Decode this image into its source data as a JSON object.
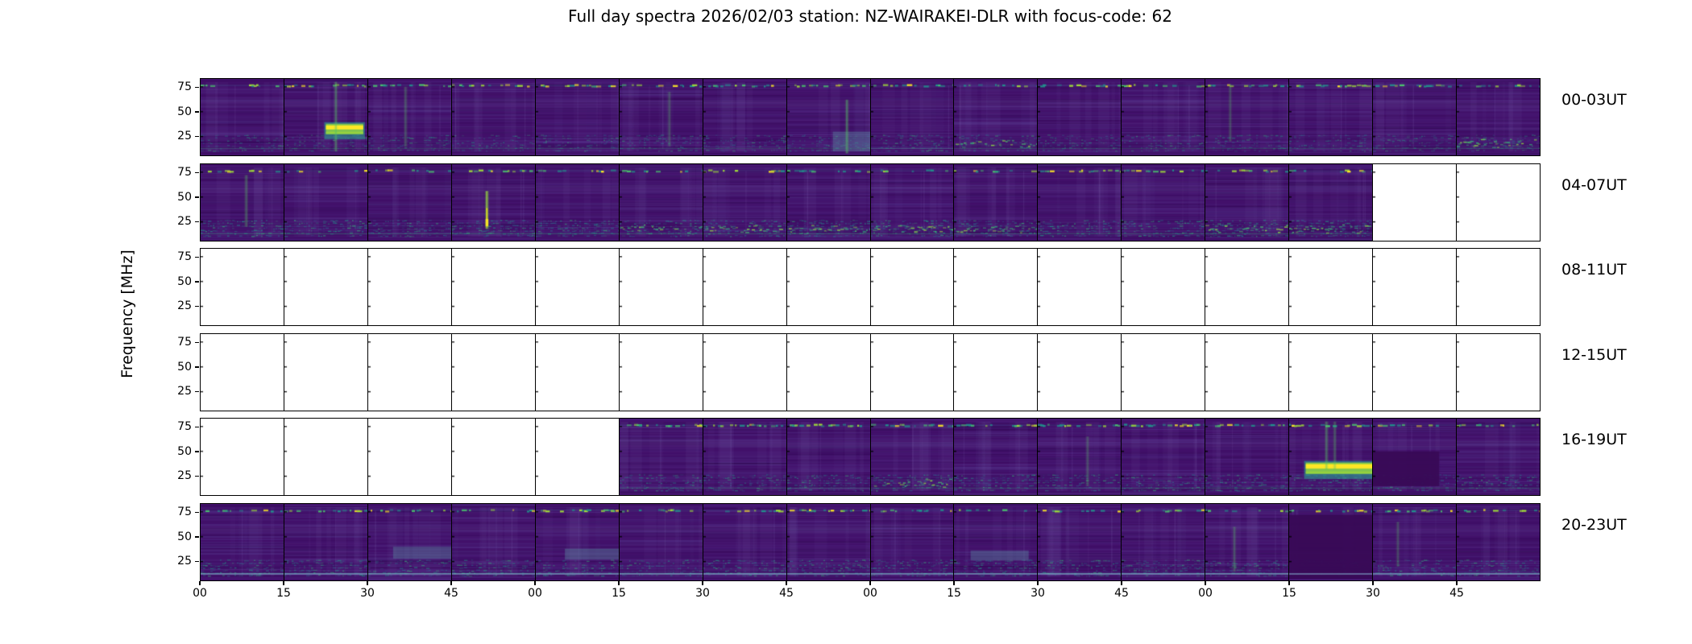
{
  "title": "Full day spectra 2026/02/03 station: NZ-WAIRAKEI-DLR with focus-code: 62",
  "ylabel": "Frequency [MHz]",
  "station": "NZ-WAIRAKEI-DLR",
  "date": "2026/02/03",
  "focus_code": "62",
  "colors": {
    "background": "#ffffff",
    "axis": "#000000",
    "spectrogram_base": "#42106a",
    "no_data": "#ffffff",
    "viridis_palette": [
      "#440154",
      "#46327e",
      "#365c8d",
      "#277f8e",
      "#1fa187",
      "#4ac16d",
      "#a0da39",
      "#fde725"
    ]
  },
  "chart_data": {
    "type": "heatmap",
    "subtype": "spectrogram-grid",
    "colormap": "viridis",
    "panels_per_row": 16,
    "minutes_per_panel": 15,
    "x_tick_labels": [
      "00",
      "15",
      "30",
      "45",
      "00",
      "15",
      "30",
      "45",
      "00",
      "15",
      "30",
      "45",
      "00",
      "15",
      "30",
      "45"
    ],
    "y_ticks": [
      "75",
      "50",
      "25"
    ],
    "y_tick_freqs": [
      75,
      50,
      25
    ],
    "y_range_mhz": [
      6,
      83
    ],
    "rows": [
      {
        "label": "00-03UT",
        "panels": [
          1,
          1,
          1,
          1,
          1,
          1,
          1,
          1,
          1,
          1,
          1,
          1,
          1,
          1,
          1,
          1
        ],
        "top_band": 0.5,
        "bottom_band": 0.62,
        "bottom_line": false
      },
      {
        "label": "04-07UT",
        "panels": [
          1,
          1,
          1,
          1,
          1,
          1,
          1,
          1,
          1,
          1,
          1,
          1,
          1,
          1,
          0,
          0
        ],
        "top_band": 0.45,
        "bottom_band": 0.82,
        "bottom_line": false
      },
      {
        "label": "08-11UT",
        "panels": [
          0,
          0,
          0,
          0,
          0,
          0,
          0,
          0,
          0,
          0,
          0,
          0,
          0,
          0,
          0,
          0
        ],
        "top_band": 0,
        "bottom_band": 0,
        "bottom_line": false
      },
      {
        "label": "12-15UT",
        "panels": [
          0,
          0,
          0,
          0,
          0,
          0,
          0,
          0,
          0,
          0,
          0,
          0,
          0,
          0,
          0,
          0
        ],
        "top_band": 0,
        "bottom_band": 0,
        "bottom_line": false
      },
      {
        "label": "16-19UT",
        "panels": [
          0,
          0,
          0,
          0,
          0,
          1,
          1,
          1,
          1,
          1,
          1,
          1,
          1,
          1,
          1,
          1
        ],
        "top_band": 0.55,
        "bottom_band": 0.7,
        "bottom_line": false
      },
      {
        "label": "20-23UT",
        "panels": [
          1,
          1,
          1,
          1,
          1,
          1,
          1,
          1,
          1,
          1,
          1,
          1,
          1,
          1,
          1,
          1
        ],
        "top_band": 0.42,
        "bottom_band": 0.72,
        "bottom_line": true
      }
    ],
    "features": [
      {
        "row": 0,
        "panel": 1,
        "type": "blob",
        "x0": 0.5,
        "x1": 0.95,
        "f0": 28,
        "f1": 37,
        "note": "bright narrowband emission"
      },
      {
        "row": 0,
        "panel": 1,
        "type": "vstreak",
        "x": 0.62,
        "f0": 10,
        "f1": 80,
        "intensity": 0.5
      },
      {
        "row": 0,
        "panel": 2,
        "type": "vstreak",
        "x": 0.45,
        "f0": 15,
        "f1": 75,
        "intensity": 0.35
      },
      {
        "row": 0,
        "panel": 5,
        "type": "vstreak",
        "x": 0.6,
        "f0": 15,
        "f1": 70,
        "intensity": 0.3
      },
      {
        "row": 0,
        "panel": 7,
        "type": "light-rect",
        "x0": 0.55,
        "x1": 1,
        "f0": 10,
        "f1": 30
      },
      {
        "row": 0,
        "panel": 7,
        "type": "vstreak",
        "x": 0.72,
        "f0": 8,
        "f1": 62,
        "intensity": 0.55
      },
      {
        "row": 0,
        "panel": 9,
        "type": "strong-bottom"
      },
      {
        "row": 0,
        "panel": 12,
        "type": "vstreak",
        "x": 0.3,
        "f0": 20,
        "f1": 78,
        "intensity": 0.3
      },
      {
        "row": 0,
        "panel": 15,
        "type": "strong-bottom"
      },
      {
        "row": 1,
        "panel": 0,
        "type": "vstreak",
        "x": 0.55,
        "f0": 20,
        "f1": 72,
        "intensity": 0.4
      },
      {
        "row": 1,
        "panel": 3,
        "type": "vstreak",
        "x": 0.42,
        "f0": 18,
        "f1": 56,
        "intensity": 0.95,
        "note": "strong vertical burst"
      },
      {
        "row": 1,
        "panel": 5,
        "type": "strong-bottom"
      },
      {
        "row": 1,
        "panel": 6,
        "type": "strong-bottom"
      },
      {
        "row": 1,
        "panel": 7,
        "type": "strong-bottom"
      },
      {
        "row": 1,
        "panel": 8,
        "type": "strong-bottom"
      },
      {
        "row": 1,
        "panel": 9,
        "type": "strong-bottom"
      },
      {
        "row": 1,
        "panel": 12,
        "type": "strong-bottom"
      },
      {
        "row": 1,
        "panel": 13,
        "type": "strong-bottom"
      },
      {
        "row": 4,
        "panel": 8,
        "type": "strong-bottom"
      },
      {
        "row": 4,
        "panel": 10,
        "type": "vstreak",
        "x": 0.6,
        "f0": 15,
        "f1": 65,
        "intensity": 0.3
      },
      {
        "row": 4,
        "panel": 13,
        "type": "blob",
        "x0": 0.2,
        "x1": 1.0,
        "f0": 28,
        "f1": 38,
        "note": "bright narrowband emission"
      },
      {
        "row": 4,
        "panel": 13,
        "type": "vstreak",
        "x": 0.45,
        "f0": 32,
        "f1": 80,
        "intensity": 0.5
      },
      {
        "row": 4,
        "panel": 13,
        "type": "vstreak",
        "x": 0.55,
        "f0": 32,
        "f1": 80,
        "intensity": 0.4
      },
      {
        "row": 4,
        "panel": 14,
        "type": "dark-patch",
        "x0": 0,
        "x1": 0.8,
        "f0": 15,
        "f1": 50
      },
      {
        "row": 5,
        "panel": 2,
        "type": "light-rect",
        "x0": 0.3,
        "x1": 1,
        "f0": 28,
        "f1": 40
      },
      {
        "row": 5,
        "panel": 4,
        "type": "light-rect",
        "x0": 0.35,
        "x1": 1,
        "f0": 27,
        "f1": 38
      },
      {
        "row": 5,
        "panel": 9,
        "type": "light-rect",
        "x0": 0.2,
        "x1": 0.9,
        "f0": 26,
        "f1": 36
      },
      {
        "row": 5,
        "panel": 12,
        "type": "vstreak",
        "x": 0.35,
        "f0": 15,
        "f1": 60,
        "intensity": 0.35
      },
      {
        "row": 5,
        "panel": 13,
        "type": "dark-patch",
        "x0": 0,
        "x1": 1,
        "f0": 8,
        "f1": 72,
        "note": "flat featureless block"
      },
      {
        "row": 5,
        "panel": 14,
        "type": "vstreak",
        "x": 0.3,
        "f0": 20,
        "f1": 65,
        "intensity": 0.3
      }
    ]
  },
  "layout_labels": {
    "row_label_suffix": "UT"
  }
}
